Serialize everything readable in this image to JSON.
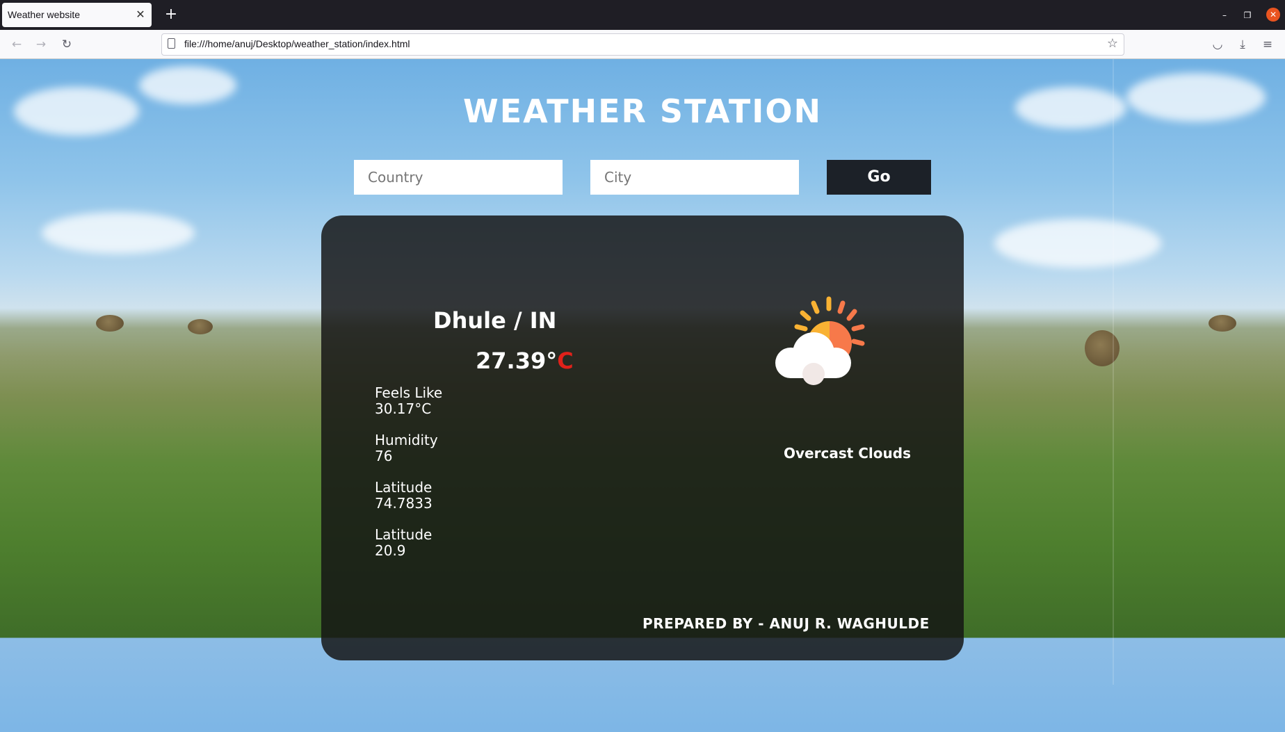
{
  "browser": {
    "tab_title": "Weather website",
    "url": "file:///home/anuj/Desktop/weather_station/index.html"
  },
  "page": {
    "title": "WEATHER STATION",
    "country_placeholder": "Country",
    "city_placeholder": "City",
    "go_label": "Go"
  },
  "weather": {
    "location": "Dhule / IN",
    "temp_value": "27.39°",
    "temp_unit": "C",
    "stats": [
      {
        "label": "Feels Like",
        "value": "30.17°C"
      },
      {
        "label": "Humidity",
        "value": "76"
      },
      {
        "label": "Latitude",
        "value": "74.7833"
      },
      {
        "label": "Latitude",
        "value": "20.9"
      }
    ],
    "description": "Overcast Clouds",
    "icon": "partly-cloudy-icon"
  },
  "footer": {
    "credit": "PREPARED BY - ANUJ R. WAGHULDE"
  },
  "colors": {
    "temp_unit": "#e0211a",
    "go_button": "#1c2128",
    "card": "rgba(20,20,20,0.84)",
    "sun": "#f9b233",
    "sun_rays": "#f7794a"
  }
}
